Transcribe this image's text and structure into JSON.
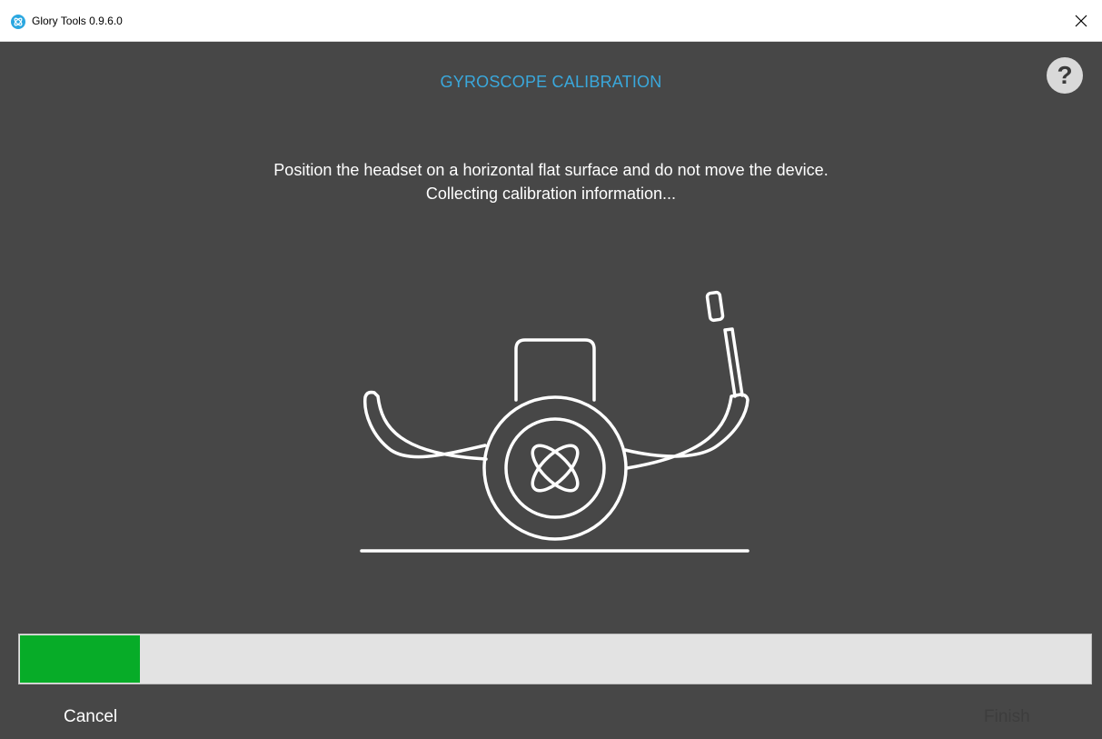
{
  "window": {
    "title": "Glory Tools 0.9.6.0",
    "app_icon": "glory-logo-icon",
    "close_icon": "close-icon"
  },
  "page": {
    "title": "GYROSCOPE CALIBRATION",
    "title_color": "#3aa8dc",
    "help_label": "?",
    "instruction_line1": "Position the headset on a horizontal flat surface and do not move the device.",
    "instruction_line2": "Collecting calibration information...",
    "illustration_icon": "headset-on-flat-surface-icon"
  },
  "progress": {
    "value_percent": 11.2,
    "fill_color": "#07ac28"
  },
  "footer": {
    "cancel_label": "Cancel",
    "finish_label": "Finish",
    "finish_enabled": false
  }
}
